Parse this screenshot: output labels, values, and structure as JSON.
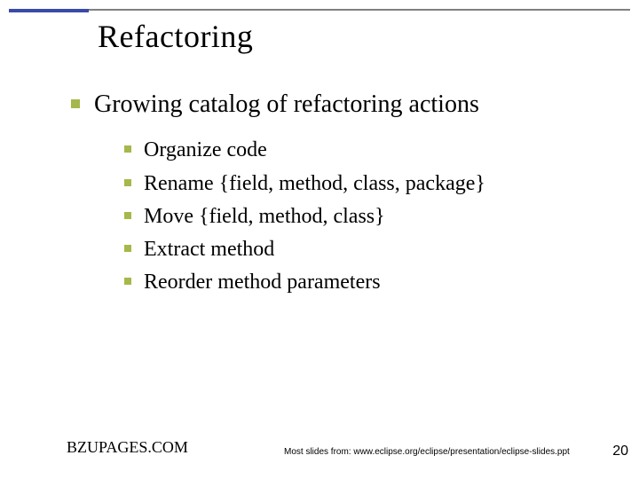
{
  "title": "Refactoring",
  "main_bullet": "Growing catalog of refactoring actions",
  "sub_bullets": [
    "Organize code",
    "Rename {field, method, class, package}",
    "Move {field, method, class}",
    "Extract method",
    "Reorder method parameters"
  ],
  "footer": {
    "left": "BZUPAGES.COM",
    "center": "Most slides from: www.eclipse.org/eclipse/presentation/eclipse-slides.ppt",
    "right": "20"
  },
  "colors": {
    "accent_bullet": "#a6b84a",
    "title_underline": "#3a4aa8",
    "rule": "#808080"
  }
}
